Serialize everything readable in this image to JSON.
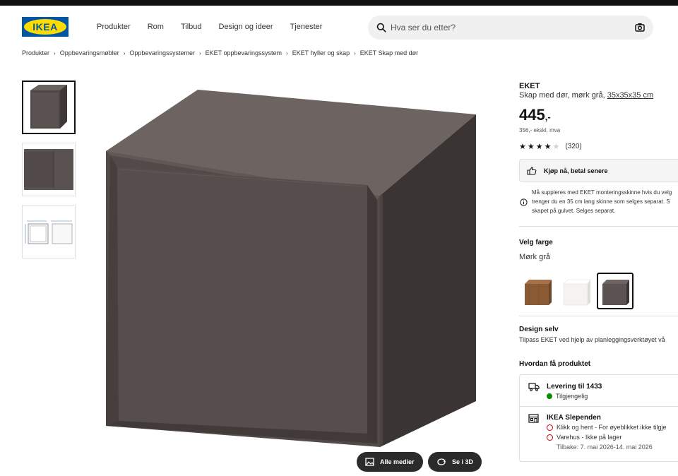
{
  "header": {
    "logo_text": "IKEA",
    "nav": [
      "Produkter",
      "Rom",
      "Tilbud",
      "Design og ideer",
      "Tjenester"
    ],
    "search_placeholder": "Hva ser du etter?",
    "search_icon": "search-icon",
    "camera_icon": "camera-icon"
  },
  "breadcrumb": [
    "Produkter",
    "Oppbevaringsmøbler",
    "Oppbevaringssystemer",
    "EKET oppbevaringssystem",
    "EKET hyller og skap",
    "EKET Skap med dør"
  ],
  "gallery": {
    "thumbnails": [
      "cabinet-front",
      "cabinet-detail",
      "dimension-drawing"
    ],
    "buttons": {
      "all_media": "Alle medier",
      "view_3d": "Se i 3D"
    }
  },
  "product": {
    "name": "EKET",
    "description": "Skap med dør, mørk grå, ",
    "size_link": "35x35x35 cm",
    "price": "445",
    "price_suffix": ",-",
    "ex_vat": "356,- ekskl. mva",
    "rating": {
      "stars": 4,
      "max": 5,
      "count": "(320)"
    },
    "buy_now_label": "Kjøp nå, betal senere",
    "info_lines": [
      "Må suppleres med EKET monteringsskinne hvis du velg",
      "trenger du en 35 cm lang skinne som selges separat. S",
      "skapet på gulvet. Selges separat."
    ]
  },
  "color": {
    "heading": "Velg farge",
    "selected": "Mørk grå",
    "options": [
      {
        "name": "walnut",
        "hex": "#8a5a34"
      },
      {
        "name": "white",
        "hex": "#f4f3ef"
      },
      {
        "name": "dark-grey",
        "hex": "#5b5351"
      }
    ]
  },
  "design": {
    "heading": "Design selv",
    "text": "Tilpass EKET ved hjelp av planleggingsverktøyet vå"
  },
  "delivery": {
    "heading": "Hvordan få produktet",
    "shipping_title": "Levering til 1433",
    "shipping_status": "Tilgjengelig",
    "store_title": "IKEA Slependen",
    "store_lines": [
      "Klikk og hent - For øyeblikket ikke tilgje",
      "Varehus - Ikke på lager"
    ],
    "restock": "Tilbake: 7. mai 2026-14. mai 2026",
    "status_colors": {
      "available": "#0a8a00",
      "unavailable": "#cc0008"
    }
  }
}
